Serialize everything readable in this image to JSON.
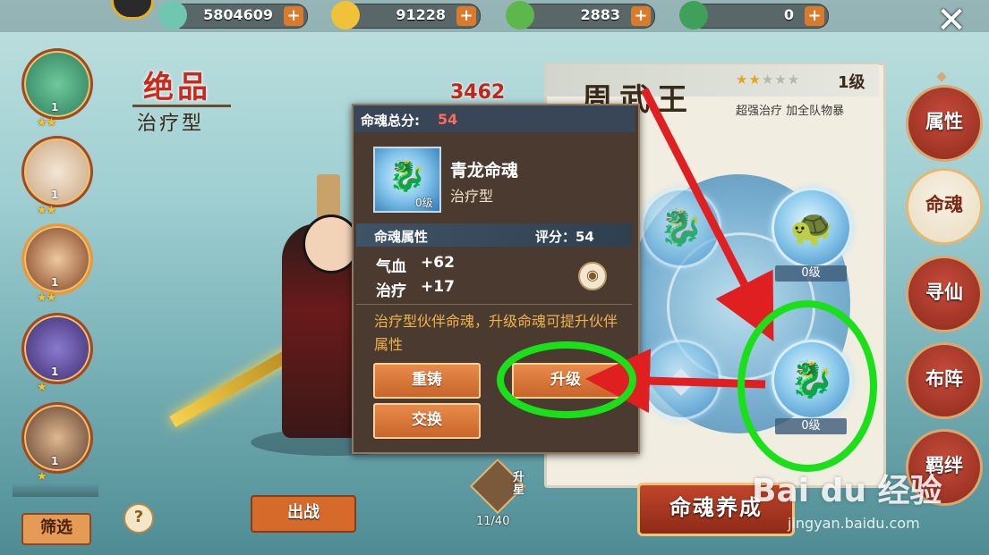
{
  "resources": [
    {
      "name": "silver",
      "value": "5804609"
    },
    {
      "name": "ingot",
      "value": "91228"
    },
    {
      "name": "jade",
      "value": "2883"
    },
    {
      "name": "jade2",
      "value": "0"
    }
  ],
  "plus_label": "+",
  "close_label": "✕",
  "partners": [
    {
      "level": "1",
      "stars": "★★"
    },
    {
      "level": "1",
      "stars": "★★"
    },
    {
      "level": "1",
      "stars": "★★"
    },
    {
      "level": "1",
      "stars": "★"
    },
    {
      "level": "1",
      "stars": "★"
    }
  ],
  "filter_label": "筛选",
  "help_label": "?",
  "hero": {
    "quality": "绝品",
    "type": "治疗型",
    "power": "3462",
    "name": "周武王",
    "rank_level": "1级",
    "description": "超强治疗 加全队物暴",
    "stars_on": "★★",
    "stars_off": "★★★"
  },
  "fight_label": "出战",
  "star_up": {
    "label": "升星",
    "progress": "11/40"
  },
  "soul_wheel": {
    "slots": [
      {
        "level": "0级"
      },
      {
        "level": "0级"
      }
    ],
    "train_label": "命魂养成"
  },
  "nav": [
    "属性",
    "命魂",
    "寻仙",
    "布阵",
    "羁绊"
  ],
  "nav_active": "命魂",
  "popup": {
    "total_label": "命魂总分:",
    "total_value": "54",
    "soul_name": "青龙命魂",
    "soul_type": "治疗型",
    "soul_level": "0级",
    "attr_title": "命魂属性",
    "score": "评分：54",
    "stats": [
      {
        "label": "气血",
        "value": "+62"
      },
      {
        "label": "治疗",
        "value": "+17"
      }
    ],
    "description": "治疗型伙伴命魂，升级命魂可提升伙伴属性",
    "buttons": {
      "recast": "重铸",
      "upgrade": "升级",
      "swap": "交换"
    }
  },
  "watermark": {
    "brand": "Bai du 经验",
    "url": "jingyan.baidu.com"
  },
  "colors": {
    "accent_orange": "#d97b2a",
    "annotation_red": "#e02020",
    "annotation_green": "#19e019",
    "quality_red": "#c92a1c"
  }
}
